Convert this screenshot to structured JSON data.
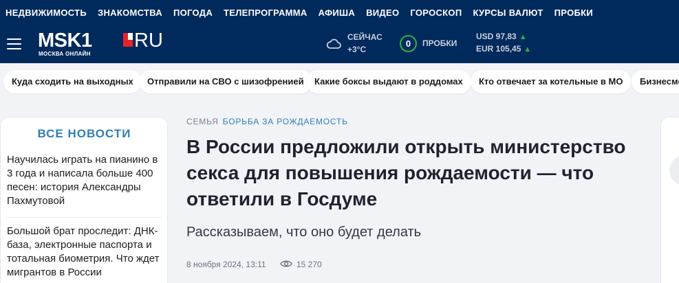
{
  "top_nav": [
    "НЕДВИЖИМОСТЬ",
    "ЗНАКОМСТВА",
    "ПОГОДА",
    "ТЕЛЕПРОГРАММА",
    "АФИША",
    "ВИДЕО",
    "ГОРОСКОП",
    "КУРСЫ ВАЛЮТ",
    "ПРОБКИ"
  ],
  "logo": {
    "word": "MSK1",
    "ru": "RU",
    "sub": "МОСКВА ОНЛАЙН"
  },
  "weather": {
    "label": "СЕЙЧАС",
    "temp": "+3°C",
    "icon": "cloud-icon"
  },
  "traffic": {
    "score": "0",
    "label": "ПРОБКИ"
  },
  "currency": {
    "usd": "USD 97,83",
    "eur": "EUR 105,45",
    "trend_color": "#2bb24c"
  },
  "tags": [
    "Куда сходить на выходных",
    "Отправили на СВО с шизофренией",
    "Какие боксы выдают в роддомах",
    "Кто отвечает за котельные в МО",
    "Бизнесме"
  ],
  "sidebar": {
    "heading": "ВСЕ НОВОСТИ",
    "news": [
      "Научилась играть на пианино в 3 года и написала больше 400 песен: история Александры Пахмутовой",
      "Большой брат проследит: ДНК-база, электронные паспорта и тотальная биометрия. Что ждет мигрантов в России"
    ]
  },
  "article": {
    "category": "СЕМЬЯ",
    "rubric": "БОРЬБА ЗА РОЖДАЕМОСТЬ",
    "title": "В России предложили открыть министерство секса для повышения рождаемости — что ответили в Госдуме",
    "subtitle": "Рассказываем, что оно будет делать",
    "date": "8 ноября 2024, 13:11",
    "views": "15 270"
  },
  "colors": {
    "header_bg": "#002a5c",
    "accent_blue": "#2f7fb4",
    "logo_red": "#e8242a"
  }
}
